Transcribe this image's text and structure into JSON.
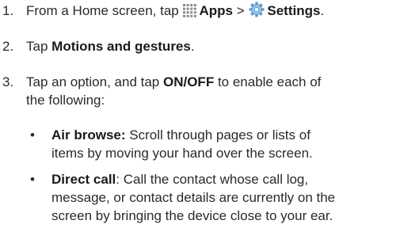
{
  "steps": [
    {
      "number": "1.",
      "pre": "From a Home screen, tap",
      "apps_icon": "apps-grid-icon",
      "apps_label": "Apps",
      "separator": ">",
      "settings_icon": "settings-gear-icon",
      "settings_label": "Settings",
      "post": "."
    },
    {
      "number": "2.",
      "pre": "Tap",
      "bold": "Motions and gestures",
      "post": "."
    },
    {
      "number": "3.",
      "line1_pre": "Tap an option, and tap",
      "line1_bold": "ON/OFF",
      "line1_post": "to enable each of",
      "line2": "the following:"
    }
  ],
  "bullets": [
    {
      "marker": "•",
      "bold": "Air browse:",
      "line1": "Scroll through pages or lists of",
      "line2": "items by moving your hand over the screen."
    },
    {
      "marker": "•",
      "bold": "Direct call",
      "line1": ": Call the contact whose call log,",
      "line2": "message, or contact details are currently on the",
      "line3": "screen by bringing the device close to your ear."
    }
  ]
}
